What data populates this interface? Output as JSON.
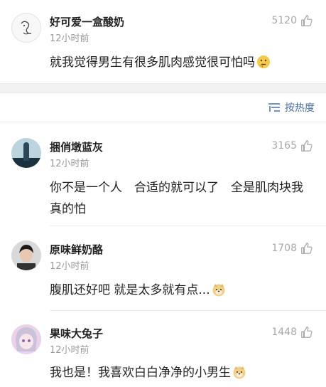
{
  "top_comment": {
    "user": "好可爱一盒酸奶",
    "time": "12小时前",
    "likes": "5120",
    "text": "就我觉得男生有很多肌肉感觉很可怕吗",
    "emoji": "thinking-emoji"
  },
  "sort": {
    "label": "按热度",
    "icon": "sort-lines-icon"
  },
  "replies": [
    {
      "user": "捆俏墩蓝灰",
      "time": "12小时前",
      "likes": "3165",
      "text": "你不是一个人　合适的就可以了　全是肌肉块我真的怕"
    },
    {
      "user": "原味鲜奶酪",
      "time": "12小时前",
      "likes": "1708",
      "text": "腹肌还好吧 就是太多就有点...",
      "emoji": "doge-emoji"
    },
    {
      "user": "果味大兔子",
      "time": "12小时前",
      "likes": "1448",
      "text": "我也是！我喜欢白白净净的小男生",
      "emoji": "doge-emoji"
    }
  ],
  "colors": {
    "link": "#4a6ea8",
    "muted": "#9a9a9a",
    "separator": "#f2f2f2"
  }
}
